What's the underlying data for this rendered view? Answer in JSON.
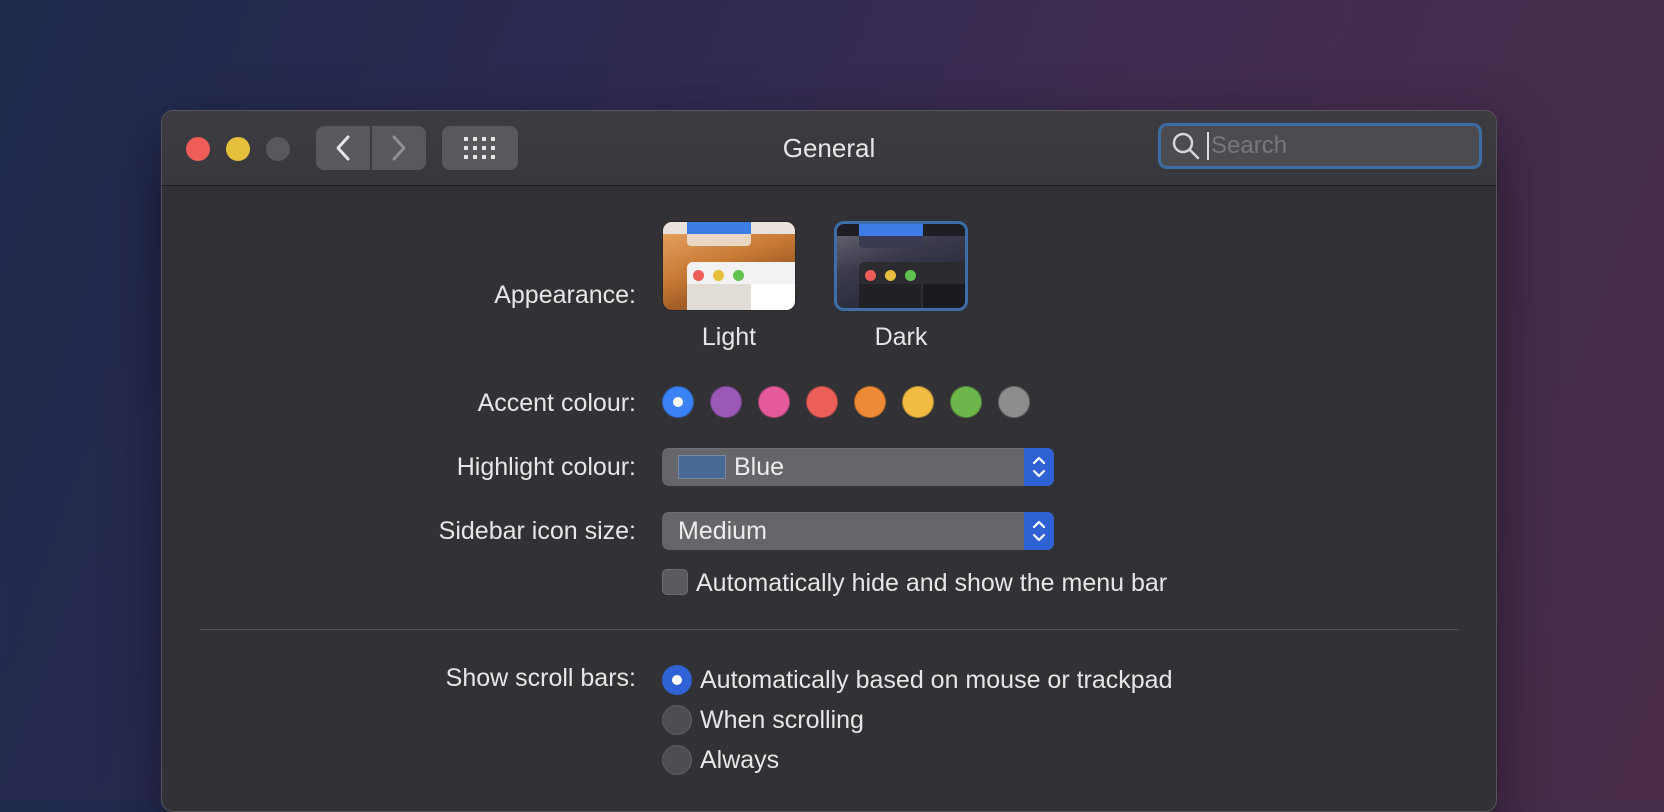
{
  "window": {
    "title": "General",
    "search": {
      "placeholder": "Search",
      "value": ""
    }
  },
  "appearance": {
    "label": "Appearance:",
    "options": [
      {
        "name": "Light",
        "selected": false
      },
      {
        "name": "Dark",
        "selected": true
      }
    ]
  },
  "accent": {
    "label": "Accent colour:",
    "colors": [
      "#3b82f6",
      "#9b59b6",
      "#e55a9b",
      "#ec5f59",
      "#ee8a35",
      "#f2bc42",
      "#6cb64b",
      "#8c8c8c"
    ],
    "selected_index": 0
  },
  "highlight": {
    "label": "Highlight colour:",
    "value": "Blue",
    "chip_color": "#476a95"
  },
  "sidebar_icon_size": {
    "label": "Sidebar icon size:",
    "value": "Medium"
  },
  "menubar": {
    "label": "Automatically hide and show the menu bar",
    "checked": false
  },
  "scroll_bars": {
    "label": "Show scroll bars:",
    "options": [
      {
        "label": "Automatically based on mouse or trackpad",
        "selected": true
      },
      {
        "label": "When scrolling",
        "selected": false
      },
      {
        "label": "Always",
        "selected": false
      }
    ]
  }
}
